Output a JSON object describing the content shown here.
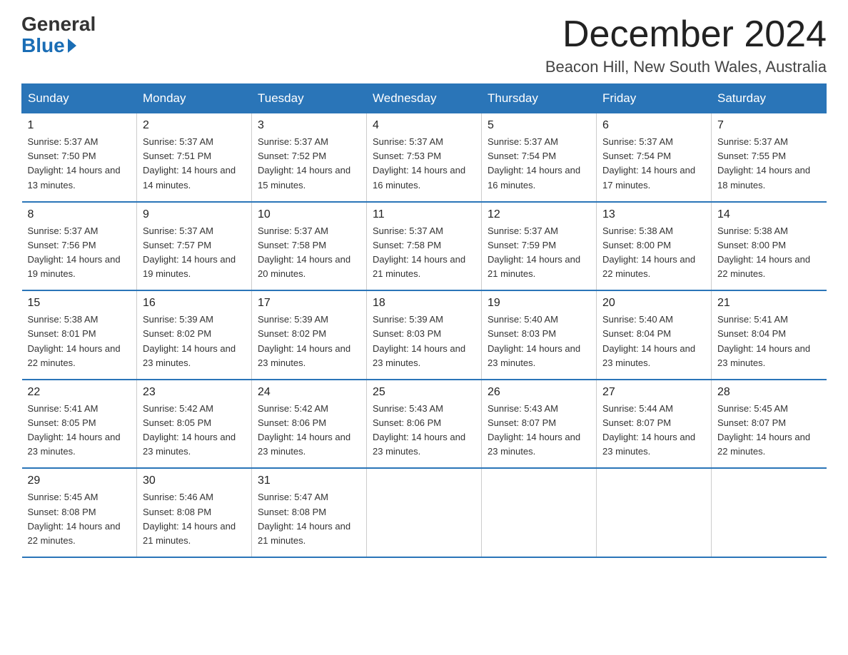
{
  "logo": {
    "general": "General",
    "blue": "Blue"
  },
  "title": "December 2024",
  "location": "Beacon Hill, New South Wales, Australia",
  "days_header": [
    "Sunday",
    "Monday",
    "Tuesday",
    "Wednesday",
    "Thursday",
    "Friday",
    "Saturday"
  ],
  "weeks": [
    [
      {
        "day": "1",
        "sunrise": "5:37 AM",
        "sunset": "7:50 PM",
        "daylight": "14 hours and 13 minutes."
      },
      {
        "day": "2",
        "sunrise": "5:37 AM",
        "sunset": "7:51 PM",
        "daylight": "14 hours and 14 minutes."
      },
      {
        "day": "3",
        "sunrise": "5:37 AM",
        "sunset": "7:52 PM",
        "daylight": "14 hours and 15 minutes."
      },
      {
        "day": "4",
        "sunrise": "5:37 AM",
        "sunset": "7:53 PM",
        "daylight": "14 hours and 16 minutes."
      },
      {
        "day": "5",
        "sunrise": "5:37 AM",
        "sunset": "7:54 PM",
        "daylight": "14 hours and 16 minutes."
      },
      {
        "day": "6",
        "sunrise": "5:37 AM",
        "sunset": "7:54 PM",
        "daylight": "14 hours and 17 minutes."
      },
      {
        "day": "7",
        "sunrise": "5:37 AM",
        "sunset": "7:55 PM",
        "daylight": "14 hours and 18 minutes."
      }
    ],
    [
      {
        "day": "8",
        "sunrise": "5:37 AM",
        "sunset": "7:56 PM",
        "daylight": "14 hours and 19 minutes."
      },
      {
        "day": "9",
        "sunrise": "5:37 AM",
        "sunset": "7:57 PM",
        "daylight": "14 hours and 19 minutes."
      },
      {
        "day": "10",
        "sunrise": "5:37 AM",
        "sunset": "7:58 PM",
        "daylight": "14 hours and 20 minutes."
      },
      {
        "day": "11",
        "sunrise": "5:37 AM",
        "sunset": "7:58 PM",
        "daylight": "14 hours and 21 minutes."
      },
      {
        "day": "12",
        "sunrise": "5:37 AM",
        "sunset": "7:59 PM",
        "daylight": "14 hours and 21 minutes."
      },
      {
        "day": "13",
        "sunrise": "5:38 AM",
        "sunset": "8:00 PM",
        "daylight": "14 hours and 22 minutes."
      },
      {
        "day": "14",
        "sunrise": "5:38 AM",
        "sunset": "8:00 PM",
        "daylight": "14 hours and 22 minutes."
      }
    ],
    [
      {
        "day": "15",
        "sunrise": "5:38 AM",
        "sunset": "8:01 PM",
        "daylight": "14 hours and 22 minutes."
      },
      {
        "day": "16",
        "sunrise": "5:39 AM",
        "sunset": "8:02 PM",
        "daylight": "14 hours and 23 minutes."
      },
      {
        "day": "17",
        "sunrise": "5:39 AM",
        "sunset": "8:02 PM",
        "daylight": "14 hours and 23 minutes."
      },
      {
        "day": "18",
        "sunrise": "5:39 AM",
        "sunset": "8:03 PM",
        "daylight": "14 hours and 23 minutes."
      },
      {
        "day": "19",
        "sunrise": "5:40 AM",
        "sunset": "8:03 PM",
        "daylight": "14 hours and 23 minutes."
      },
      {
        "day": "20",
        "sunrise": "5:40 AM",
        "sunset": "8:04 PM",
        "daylight": "14 hours and 23 minutes."
      },
      {
        "day": "21",
        "sunrise": "5:41 AM",
        "sunset": "8:04 PM",
        "daylight": "14 hours and 23 minutes."
      }
    ],
    [
      {
        "day": "22",
        "sunrise": "5:41 AM",
        "sunset": "8:05 PM",
        "daylight": "14 hours and 23 minutes."
      },
      {
        "day": "23",
        "sunrise": "5:42 AM",
        "sunset": "8:05 PM",
        "daylight": "14 hours and 23 minutes."
      },
      {
        "day": "24",
        "sunrise": "5:42 AM",
        "sunset": "8:06 PM",
        "daylight": "14 hours and 23 minutes."
      },
      {
        "day": "25",
        "sunrise": "5:43 AM",
        "sunset": "8:06 PM",
        "daylight": "14 hours and 23 minutes."
      },
      {
        "day": "26",
        "sunrise": "5:43 AM",
        "sunset": "8:07 PM",
        "daylight": "14 hours and 23 minutes."
      },
      {
        "day": "27",
        "sunrise": "5:44 AM",
        "sunset": "8:07 PM",
        "daylight": "14 hours and 23 minutes."
      },
      {
        "day": "28",
        "sunrise": "5:45 AM",
        "sunset": "8:07 PM",
        "daylight": "14 hours and 22 minutes."
      }
    ],
    [
      {
        "day": "29",
        "sunrise": "5:45 AM",
        "sunset": "8:08 PM",
        "daylight": "14 hours and 22 minutes."
      },
      {
        "day": "30",
        "sunrise": "5:46 AM",
        "sunset": "8:08 PM",
        "daylight": "14 hours and 21 minutes."
      },
      {
        "day": "31",
        "sunrise": "5:47 AM",
        "sunset": "8:08 PM",
        "daylight": "14 hours and 21 minutes."
      },
      null,
      null,
      null,
      null
    ]
  ]
}
